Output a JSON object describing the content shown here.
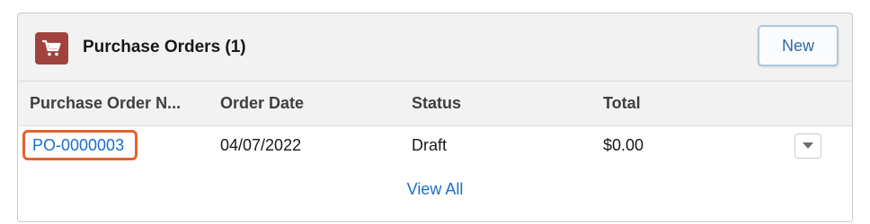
{
  "card": {
    "title": "Purchase Orders (1)",
    "icon": "cart-icon",
    "icon_color": "#a0433f",
    "new_button_label": "New"
  },
  "table": {
    "columns": [
      "Purchase Order N...",
      "Order Date",
      "Status",
      "Total"
    ],
    "rows": [
      {
        "purchase_order_number": "PO-0000003",
        "order_date": "04/07/2022",
        "status": "Draft",
        "total": "$0.00"
      }
    ]
  },
  "footer": {
    "view_all_label": "View All"
  },
  "colors": {
    "link": "#1b6fc4",
    "highlight": "#e6612f"
  }
}
